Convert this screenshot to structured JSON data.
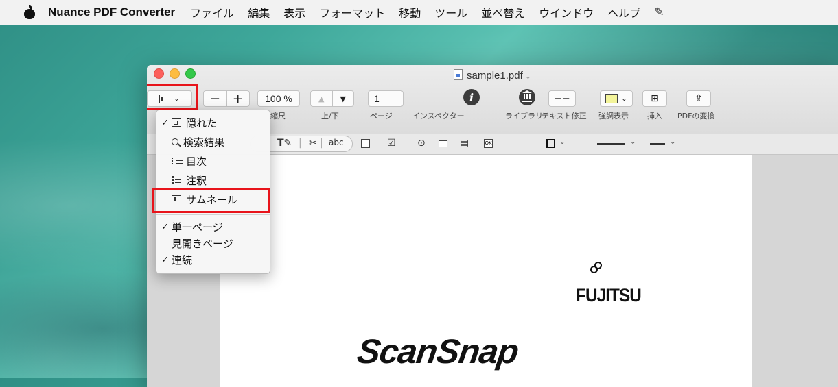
{
  "menubar": {
    "app_name": "Nuance PDF Converter",
    "items": [
      "ファイル",
      "編集",
      "表示",
      "フォーマット",
      "移動",
      "ツール",
      "並べ替え",
      "ウインドウ",
      "ヘルプ"
    ],
    "extra_icon": "script-icon"
  },
  "window": {
    "title": "sample1.pdf",
    "toolbar": {
      "zoom_minus": "−",
      "zoom_plus": "+",
      "zoom_value": "100 %",
      "zoom_label": "縮尺",
      "updown_label": "上/下",
      "page_value": "1",
      "page_label": "ページ",
      "inspector_label": "インスペクター",
      "library_label": "ライブラリ",
      "text_edit_label": "テキスト修正",
      "highlight_label": "強調表示",
      "insert_label": "挿入",
      "convert_label": "PDFの変換",
      "highlight_color": "#f3f49a"
    }
  },
  "view_menu": {
    "items": [
      {
        "check": "✓",
        "label": "隠れた",
        "icon": "hidden-panel-icon"
      },
      {
        "check": "",
        "label": "検索結果",
        "icon": "search-icon"
      },
      {
        "check": "",
        "label": "目次",
        "icon": "toc-icon"
      },
      {
        "check": "",
        "label": "注釈",
        "icon": "annotations-icon"
      },
      {
        "check": "",
        "label": "サムネール",
        "icon": "thumbnail-icon"
      }
    ],
    "page_modes": [
      {
        "check": "✓",
        "label": "単一ページ"
      },
      {
        "check": "",
        "label": "見開きページ"
      },
      {
        "check": "✓",
        "label": "連続"
      }
    ]
  },
  "document": {
    "logo_fujitsu": "FUJITSU",
    "logo_scansnap": "ScanSnap"
  },
  "colors": {
    "highlight_box": "#e8141b"
  }
}
